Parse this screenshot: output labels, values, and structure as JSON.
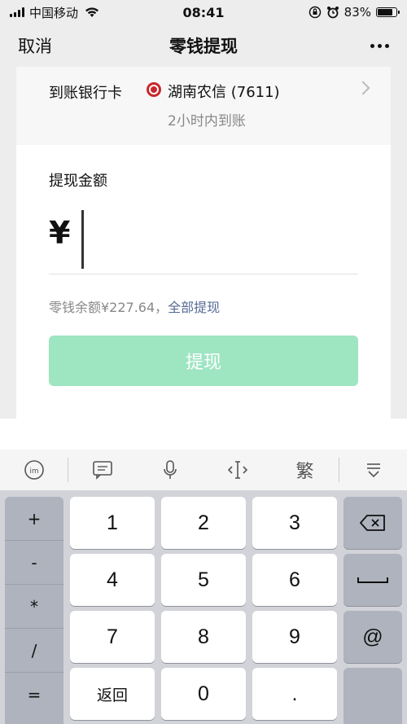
{
  "status_bar": {
    "carrier": "中国移动",
    "time": "08:41",
    "battery": "83%",
    "battery_level": 0.83
  },
  "nav": {
    "cancel_label": "取消",
    "title": "零钱提现"
  },
  "bank_card": {
    "label": "到账银行卡",
    "bank_name": "湖南农信 (7611)",
    "arrival_time": "2小时内到账"
  },
  "withdraw": {
    "amount_label": "提现金额",
    "currency_symbol": "¥",
    "balance_text": "零钱余额¥227.64，",
    "withdraw_all_label": "全部提现",
    "button_label": "提现",
    "button_color": "#9ee5c1"
  },
  "keyboard_toolbar": {
    "items": [
      "ime-icon",
      "message-icon",
      "mic-icon",
      "cursor-icon",
      "繁",
      "collapse-icon"
    ],
    "traditional_label": "繁"
  },
  "keyboard": {
    "symbols": [
      "+",
      "-",
      "*",
      "/",
      "="
    ],
    "keys": {
      "k1": "1",
      "k2": "2",
      "k3": "3",
      "k4": "4",
      "k5": "5",
      "k6": "6",
      "k7": "7",
      "k8": "8",
      "k9": "9",
      "back": "返回",
      "k0": "0",
      "dot": ".",
      "at": "@"
    }
  }
}
